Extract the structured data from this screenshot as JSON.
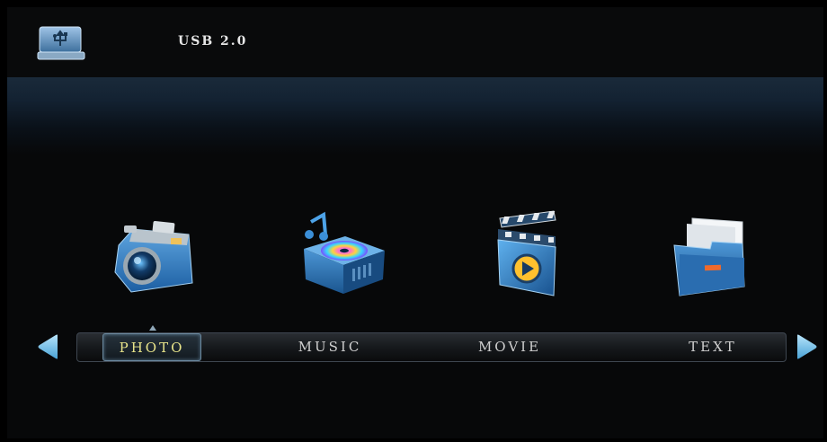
{
  "header": {
    "device_icon": "usb-drive-icon",
    "title": "USB 2.0"
  },
  "media_icons": [
    "camera-icon",
    "music-disc-player-icon",
    "clapperboard-movie-icon",
    "folder-document-icon"
  ],
  "menu": {
    "items": [
      {
        "label": "PHOTO",
        "selected": true
      },
      {
        "label": "MUSIC",
        "selected": false
      },
      {
        "label": "MOVIE",
        "selected": false
      },
      {
        "label": "TEXT",
        "selected": false
      }
    ],
    "left_arrow_icon": "arrow-left-icon",
    "right_arrow_icon": "arrow-right-icon"
  },
  "colors": {
    "background": "#070809",
    "header_band": "#132232",
    "selected_text": "#e8e48a",
    "menu_text": "#cfcfcf",
    "arrow": "#7fc4ea"
  }
}
